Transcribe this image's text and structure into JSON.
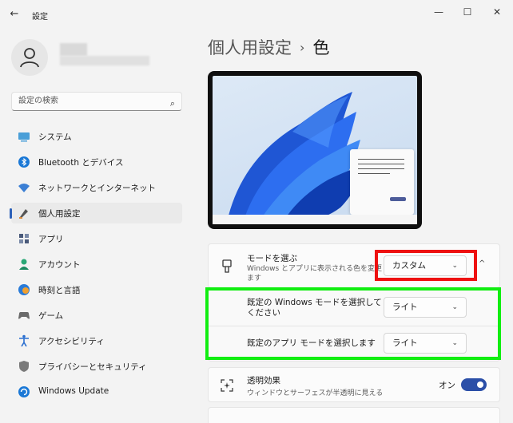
{
  "window": {
    "title": "設定",
    "back_icon": "back-arrow-icon",
    "controls": [
      "minimize-icon",
      "maximize-icon",
      "close-icon"
    ]
  },
  "search": {
    "placeholder": "設定の検索"
  },
  "sidebar": {
    "items": [
      {
        "label": "システム",
        "icon": "system-icon",
        "active": false
      },
      {
        "label": "Bluetooth とデバイス",
        "icon": "bluetooth-icon",
        "active": false
      },
      {
        "label": "ネットワークとインターネット",
        "icon": "network-icon",
        "active": false
      },
      {
        "label": "個人用設定",
        "icon": "personalization-icon",
        "active": true
      },
      {
        "label": "アプリ",
        "icon": "apps-icon",
        "active": false
      },
      {
        "label": "アカウント",
        "icon": "account-icon",
        "active": false
      },
      {
        "label": "時刻と言語",
        "icon": "time-language-icon",
        "active": false
      },
      {
        "label": "ゲーム",
        "icon": "gaming-icon",
        "active": false
      },
      {
        "label": "アクセシビリティ",
        "icon": "accessibility-icon",
        "active": false
      },
      {
        "label": "プライバシーとセキュリティ",
        "icon": "privacy-icon",
        "active": false
      },
      {
        "label": "Windows Update",
        "icon": "windows-update-icon",
        "active": false
      }
    ]
  },
  "breadcrumb": {
    "parent": "個人用設定",
    "separator": "›",
    "current": "色"
  },
  "mode": {
    "title": "モードを選ぶ",
    "description": "Windows とアプリに表示される色を変更します",
    "value": "カスタム"
  },
  "windows_mode": {
    "label": "既定の Windows モードを選択してください",
    "value": "ライト"
  },
  "app_mode": {
    "label": "既定のアプリ モードを選択します",
    "value": "ライト"
  },
  "transparency": {
    "title": "透明効果",
    "description": "ウィンドウとサーフェスが半透明に見える",
    "state_label": "オン",
    "on": true
  },
  "colors": {
    "accent": "#2b4fa8",
    "highlight_red": "#ee1111",
    "highlight_green": "#11ee11"
  }
}
